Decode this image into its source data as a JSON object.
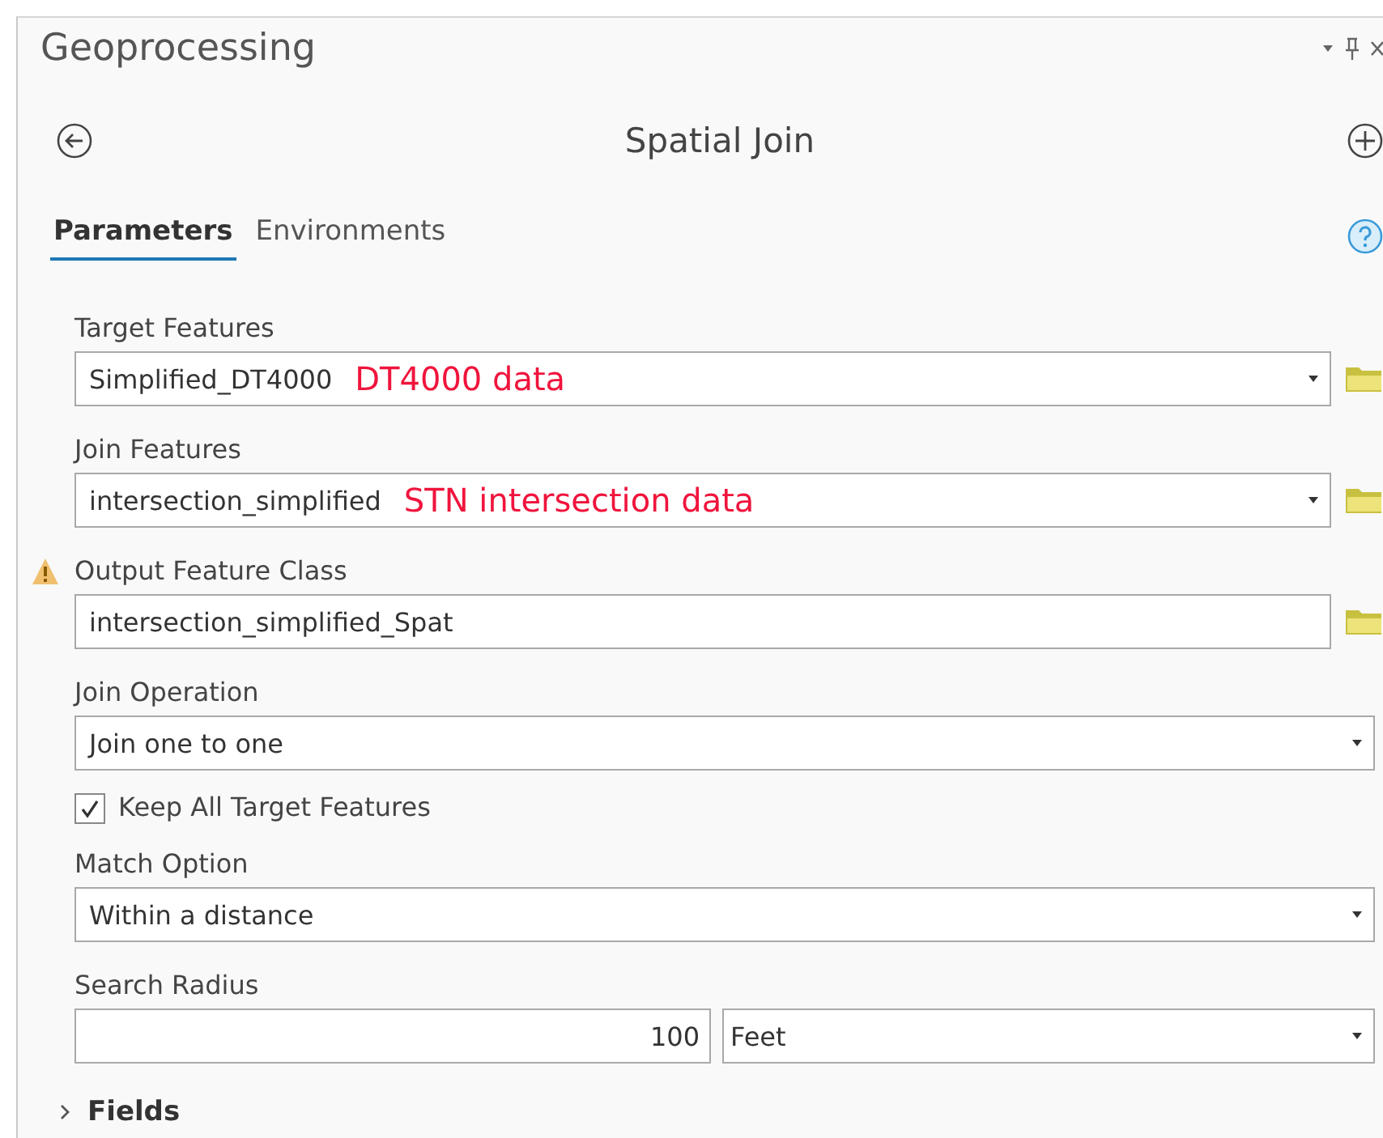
{
  "pane": {
    "title": "Geoprocessing"
  },
  "tool": {
    "title": "Spatial Join"
  },
  "tabs": [
    {
      "label": "Parameters",
      "selected": true
    },
    {
      "label": "Environments",
      "selected": false
    }
  ],
  "parameters": [
    {
      "kind": "combo",
      "label": "Target Features",
      "value": "Simplified_DT4000",
      "annotation": "DT4000 data",
      "browse": true,
      "warning": false
    },
    {
      "kind": "combo",
      "label": "Join Features",
      "value": "intersection_simplified",
      "annotation": "STN intersection data",
      "browse": true,
      "warning": false
    },
    {
      "kind": "text",
      "label": "Output Feature Class",
      "value": "intersection_simplified_Spat",
      "browse": true,
      "warning": true
    },
    {
      "kind": "combo",
      "label": "Join Operation",
      "value": "Join one to one",
      "browse": false,
      "warning": false
    },
    {
      "kind": "checkbox",
      "label": "Keep All Target Features",
      "checked": true
    },
    {
      "kind": "combo",
      "label": "Match Option",
      "value": "Within a distance",
      "browse": false,
      "warning": false
    },
    {
      "kind": "linear_unit",
      "label": "Search Radius",
      "value": "100",
      "unit": "Feet",
      "warning": false
    }
  ],
  "sections": [
    {
      "label": "Fields",
      "expanded": false
    }
  ]
}
